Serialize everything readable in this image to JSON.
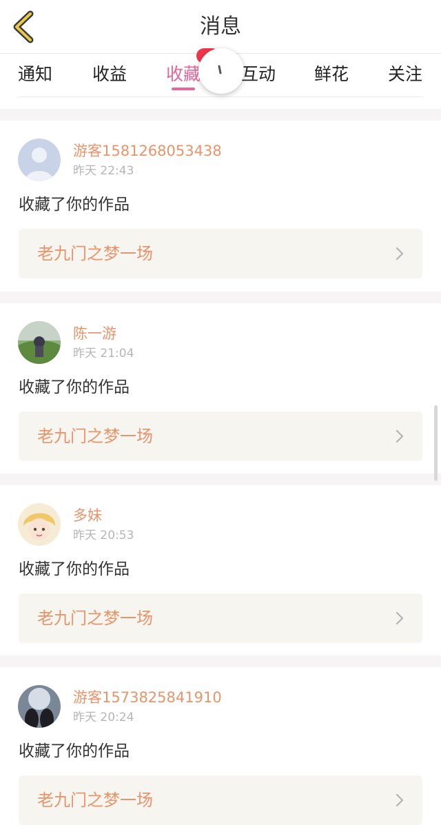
{
  "header": {
    "title": "消息"
  },
  "tabs": [
    {
      "label": "通知"
    },
    {
      "label": "收益"
    },
    {
      "label": "收藏"
    },
    {
      "label": "互动"
    },
    {
      "label": "鲜花"
    },
    {
      "label": "关注"
    }
  ],
  "active_tab": "收藏",
  "messages": [
    {
      "username": "游客1581268053438",
      "time": "昨天 22:43",
      "action": "收藏了你的作品",
      "work_title": "老九门之梦一场",
      "avatar": "default-user-avatar"
    },
    {
      "username": "陈一游",
      "time": "昨天 21:04",
      "action": "收藏了你的作品",
      "work_title": "老九门之梦一场",
      "avatar": "photo-avatar"
    },
    {
      "username": "多妹",
      "time": "昨天 20:53",
      "action": "收藏了你的作品",
      "work_title": "老九门之梦一场",
      "avatar": "anime-avatar"
    },
    {
      "username": "游客1573825841910",
      "time": "昨天 20:24",
      "action": "收藏了你的作品",
      "work_title": "老九门之梦一场",
      "avatar": "photo-avatar"
    }
  ],
  "colors": {
    "accent": "#e8649a",
    "username": "#e8946a",
    "badge": "#f0364a",
    "link_bg": "#f6f5ef"
  }
}
